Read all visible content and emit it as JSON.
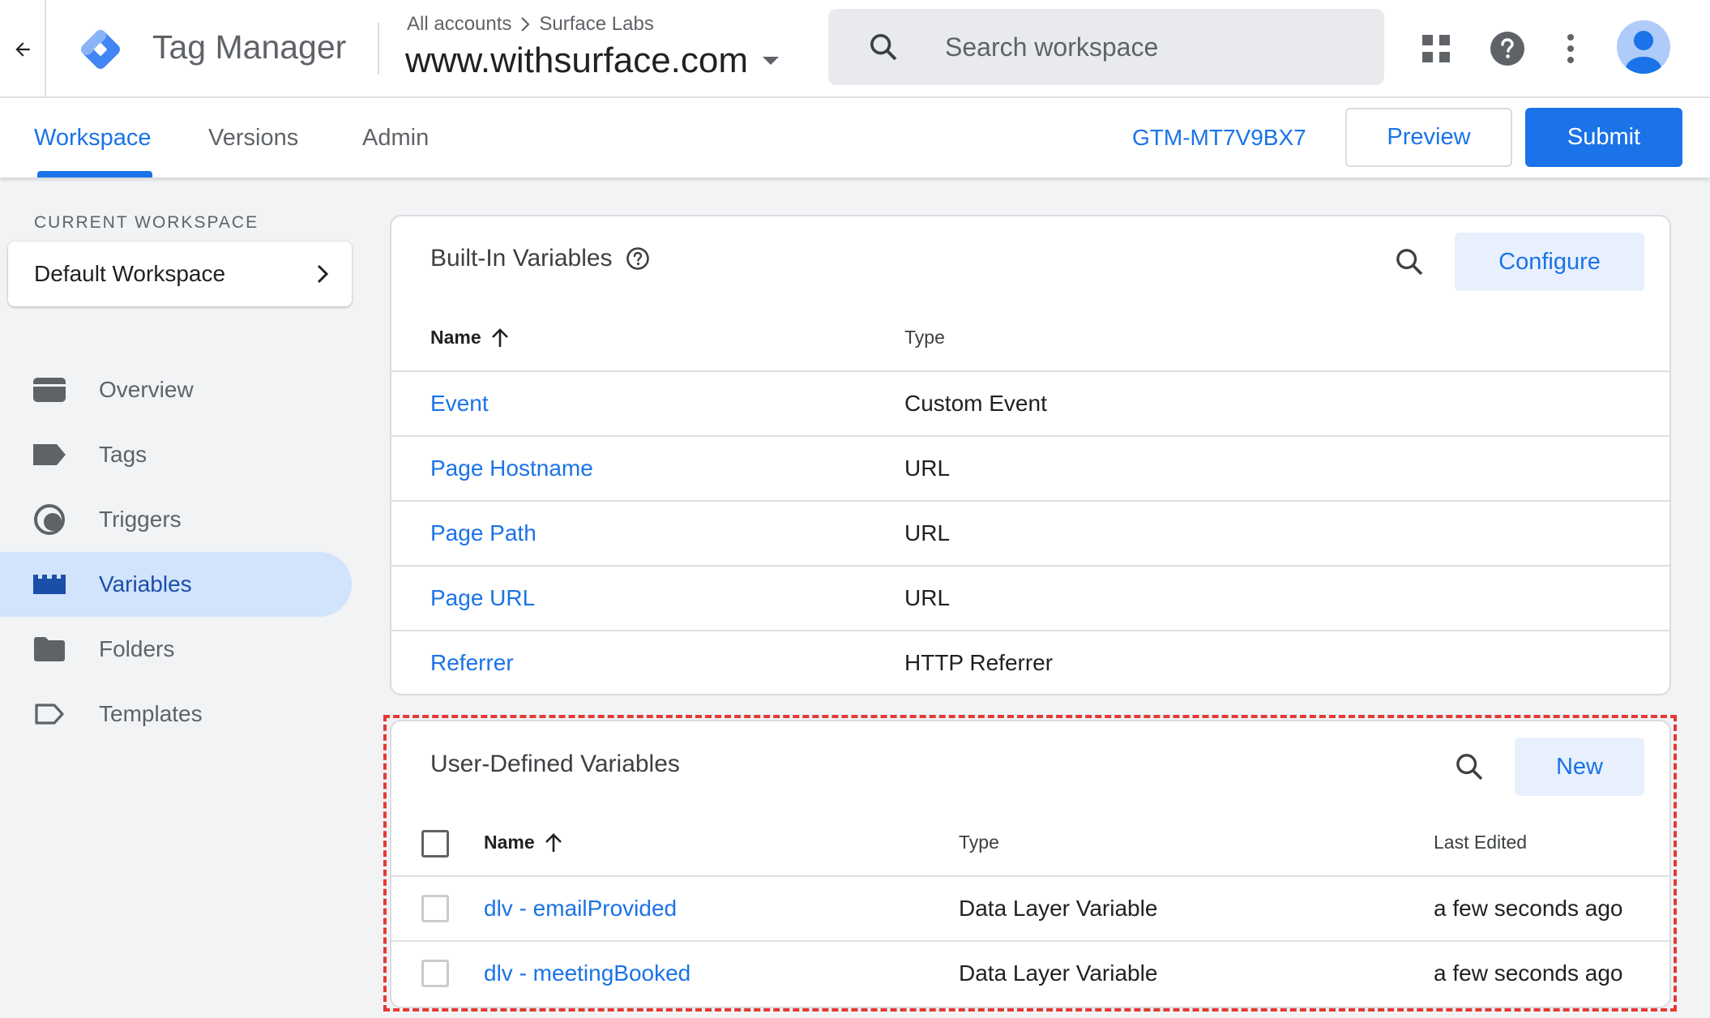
{
  "header": {
    "app_name": "Tag Manager",
    "breadcrumb": {
      "root": "All accounts",
      "account": "Surface Labs"
    },
    "container": "www.withsurface.com",
    "search_placeholder": "Search workspace",
    "icons": [
      "back-arrow-icon",
      "apps-grid-icon",
      "help-icon",
      "more-vert-icon",
      "account-avatar-icon"
    ],
    "brand_color": "#1a73e8"
  },
  "nav": {
    "tabs": [
      {
        "label": "Workspace",
        "active": true
      },
      {
        "label": "Versions",
        "active": false
      },
      {
        "label": "Admin",
        "active": false
      }
    ],
    "container_id": "GTM-MT7V9BX7",
    "preview_label": "Preview",
    "submit_label": "Submit"
  },
  "sidebar": {
    "current_workspace_label": "CURRENT WORKSPACE",
    "workspace_name": "Default Workspace",
    "items": [
      {
        "label": "Overview",
        "icon": "overview-icon",
        "active": false
      },
      {
        "label": "Tags",
        "icon": "tag-icon",
        "active": false
      },
      {
        "label": "Triggers",
        "icon": "trigger-icon",
        "active": false
      },
      {
        "label": "Variables",
        "icon": "variables-icon",
        "active": true
      },
      {
        "label": "Folders",
        "icon": "folder-icon",
        "active": false
      },
      {
        "label": "Templates",
        "icon": "template-icon",
        "active": false
      }
    ]
  },
  "builtin": {
    "title": "Built-In Variables",
    "configure_label": "Configure",
    "columns": {
      "name": "Name",
      "type": "Type"
    },
    "rows": [
      {
        "name": "Event",
        "type": "Custom Event"
      },
      {
        "name": "Page Hostname",
        "type": "URL"
      },
      {
        "name": "Page Path",
        "type": "URL"
      },
      {
        "name": "Page URL",
        "type": "URL"
      },
      {
        "name": "Referrer",
        "type": "HTTP Referrer"
      }
    ]
  },
  "userdefined": {
    "title": "User-Defined Variables",
    "new_label": "New",
    "columns": {
      "name": "Name",
      "type": "Type",
      "last_edited": "Last Edited"
    },
    "rows": [
      {
        "name": "dlv - emailProvided",
        "type": "Data Layer Variable",
        "last_edited": "a few seconds ago"
      },
      {
        "name": "dlv - meetingBooked",
        "type": "Data Layer Variable",
        "last_edited": "a few seconds ago"
      }
    ]
  },
  "annotation": {
    "highlight_color": "#e53935"
  }
}
